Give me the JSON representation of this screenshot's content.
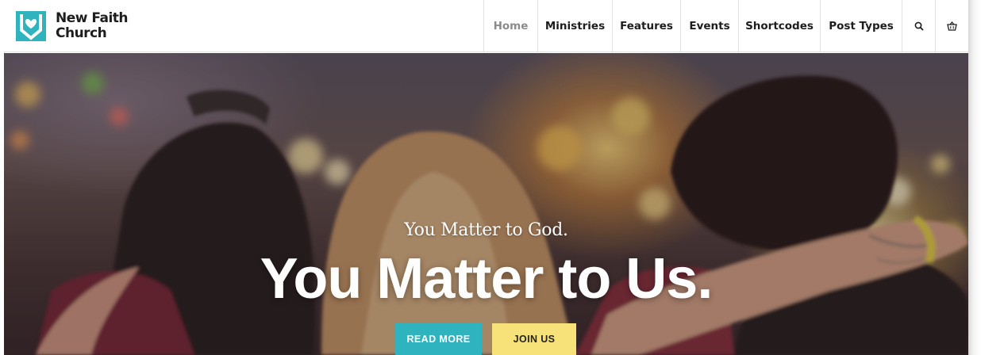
{
  "site": {
    "logo_line1": "New Faith",
    "logo_line2": "Church",
    "brand_color": "#2eb3bf"
  },
  "nav": {
    "items": [
      {
        "label": "Home",
        "active": true
      },
      {
        "label": "Ministries"
      },
      {
        "label": "Features"
      },
      {
        "label": "Events"
      },
      {
        "label": "Shortcodes"
      },
      {
        "label": "Post Types"
      }
    ],
    "search_icon": "search-icon",
    "cart_icon": "basket-icon"
  },
  "hero": {
    "kicker": "You Matter to God.",
    "headline": "You Matter to Us.",
    "primary_button": "READ MORE",
    "secondary_button": "JOIN US",
    "primary_color": "#2eb3bf",
    "secondary_color": "#f7e27a"
  }
}
